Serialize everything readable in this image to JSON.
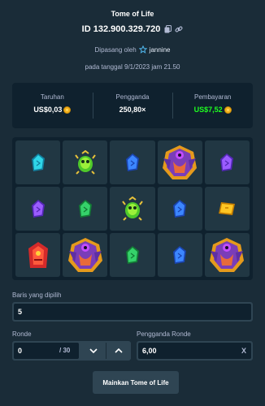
{
  "header": {
    "title": "Tome of Life",
    "bet_id": "ID 132.900.329.720",
    "placed_by_prefix": "Dipasang oleh",
    "username": "jannine",
    "date_text": "pada tanggal 9/1/2023 jam 21.50"
  },
  "stats": {
    "bet_label": "Taruhan",
    "bet_value": "US$0,03",
    "multiplier_label": "Pengganda",
    "multiplier_value": "250,80×",
    "payout_label": "Pembayaran",
    "payout_value": "US$7,52",
    "payout_color": "#1fff20"
  },
  "board": {
    "rows": [
      [
        "gem-cyan",
        "scarab-green",
        "gem-blue",
        "pharaoh-purple",
        "gem-purple"
      ],
      [
        "gem-purple",
        "gem-green",
        "scarab-green",
        "gem-red",
        "gem-gold"
      ],
      [
        "sphinx-red",
        "pharaoh-purple",
        "gem-green",
        "gem-blue",
        "pharaoh-purple"
      ]
    ]
  },
  "controls": {
    "lines_label": "Baris yang dipilih",
    "lines_value": "5",
    "rounds_label": "Ronde",
    "rounds_value": "0",
    "rounds_total": "/ 30",
    "round_multiplier_label": "Pengganda Ronde",
    "round_multiplier_value": "6,00",
    "clear_label": "X",
    "play_label": "Mainkan Tome of Life"
  },
  "colors": {
    "background": "#1a2c38",
    "panel": "#0f212e",
    "cell": "#213743",
    "border": "#2f4553",
    "coin": "#f2b01e"
  }
}
